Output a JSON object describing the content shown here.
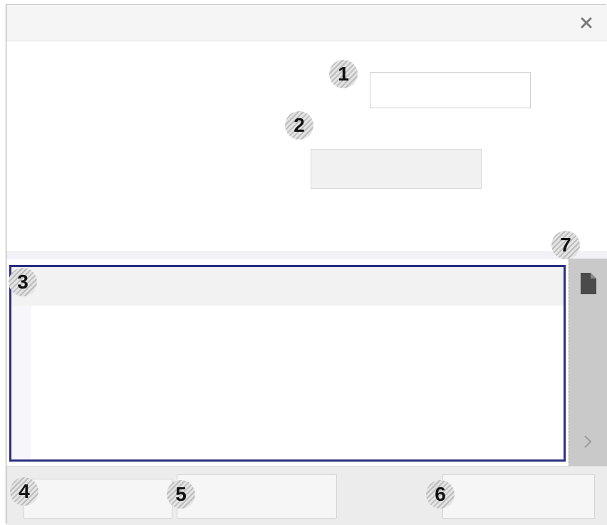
{
  "callouts": {
    "c1": "1",
    "c2": "2",
    "c3": "3",
    "c4": "4",
    "c5": "5",
    "c6": "6",
    "c7": "7"
  },
  "fields": {
    "text_input_value": "",
    "text_input_placeholder": "",
    "button_label": ""
  },
  "bottom": {
    "btn4_label": "",
    "btn5_label": "",
    "btn6_label": ""
  },
  "icons": {
    "close": "close-icon",
    "document": "document-icon",
    "chevron": "chevron-right-icon"
  },
  "colors": {
    "panel_border": "#2a2f80",
    "side_panel": "#c9c9c9"
  }
}
